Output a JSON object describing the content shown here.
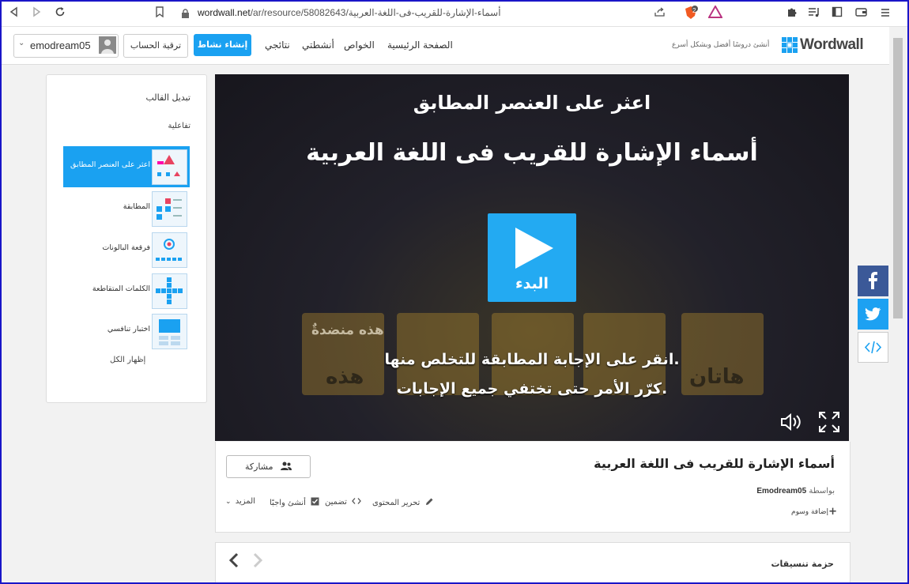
{
  "browser": {
    "url_domain": "wordwall.net",
    "url_path": "/ar/resource/58082643/أسماء-الإشارة-للقريب-فى-اللغة-العربية",
    "back_icon": "back-arrow-icon",
    "forward_icon": "forward-arrow-icon",
    "reload_icon": "reload-icon",
    "bookmark_icon": "bookmark-icon",
    "brave_badge": "2"
  },
  "header": {
    "logo_text": "Wordwall",
    "tagline": "أنشئ دروسًا أفضل وبشكل أسرع",
    "nav": [
      "الصفحة الرئيسية",
      "الخواص",
      "أنشطتي",
      "نتائجي"
    ],
    "create_label": "إنشاء نشاط",
    "upgrade_label": "ترقية الحساب",
    "username": "emodream05"
  },
  "sidebar": {
    "title": "تبديل القالب",
    "subtitle": "تفاعلية",
    "items": [
      {
        "label": "اعثر على العنصر المطابق"
      },
      {
        "label": "المطابقة"
      },
      {
        "label": "فرقعة البالونات"
      },
      {
        "label": "الكلمات المتقاطعة"
      },
      {
        "label": "اختبار تنافسي"
      }
    ],
    "show_all": "إظهار الكل"
  },
  "player": {
    "template_title": "اعثر على العنصر المطابق",
    "activity_title": "أسماء الإشارة للقريب فى اللغة العربية",
    "start_label": "البدء",
    "instruction_1": "انقر على الإجابة المطابقة للتخلص منها.",
    "instruction_2": "كرّر الأمر حتى تختفي جميع الإجابات.",
    "card_words": [
      "هذه",
      "هاتان"
    ],
    "card_overlay": "هذه منضدةٌ"
  },
  "info": {
    "title": "أسماء الإشارة للقريب فى اللغة العربية",
    "by_label": "بواسطة",
    "author": "Emodream05",
    "add_tags": "إضافة وسوم",
    "share_label": "مشاركة",
    "actions": [
      "تحرير المحتوى",
      "تضمين",
      "أنشئ واجبًا",
      "المزيد"
    ]
  },
  "bundle": {
    "title": "حزمة تنسيقات"
  },
  "colors": {
    "accent": "#1aa1f1",
    "facebook": "#3b5998",
    "twitter": "#1da1f2",
    "frame": "#1a16c8"
  }
}
